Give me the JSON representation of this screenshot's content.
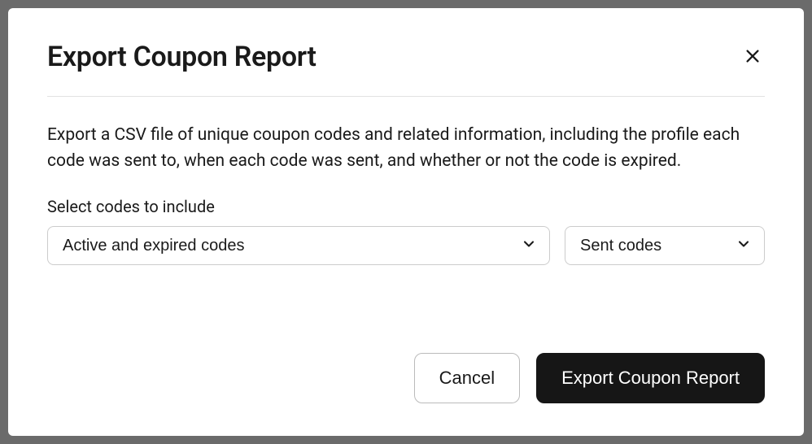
{
  "modal": {
    "title": "Export Coupon Report",
    "description": "Export a CSV file of unique coupon codes and related information, including the profile each code was sent to, when each code was sent, and whether or not the code is expired.",
    "field_label": "Select codes to include",
    "select_status": "Active and expired codes",
    "select_sent": "Sent codes",
    "cancel_label": "Cancel",
    "export_label": "Export Coupon Report"
  }
}
